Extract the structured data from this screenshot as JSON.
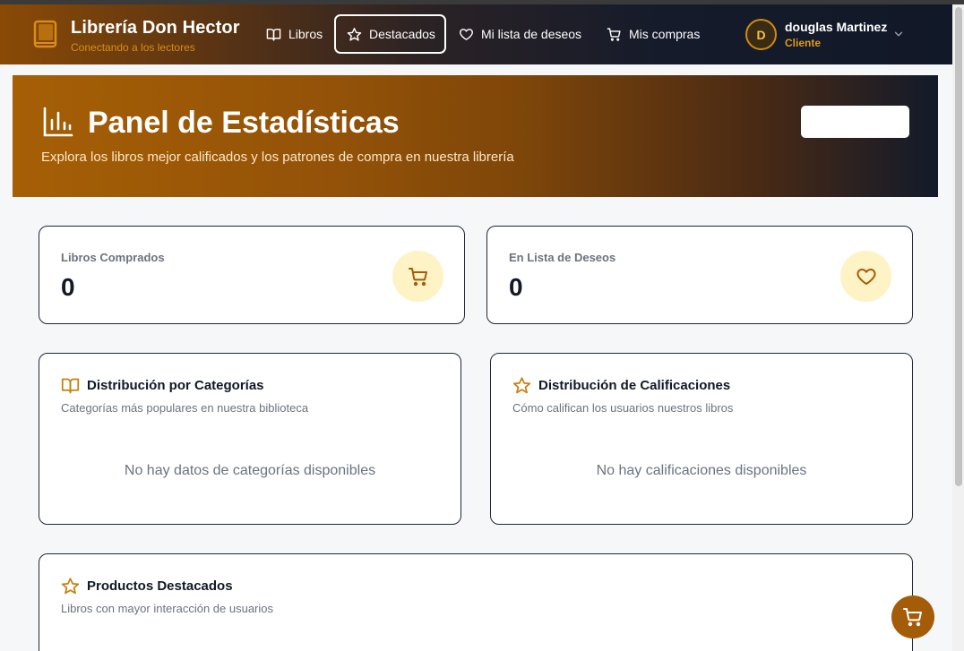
{
  "brand": {
    "title": "Librería Don Hector",
    "subtitle": "Conectando a los lectores"
  },
  "nav": {
    "items": [
      {
        "label": "Libros",
        "icon": "book-icon"
      },
      {
        "label": "Destacados",
        "icon": "star-icon",
        "active": true
      },
      {
        "label": "Mi lista de deseos",
        "icon": "heart-icon"
      },
      {
        "label": "Mis compras",
        "icon": "cart-icon"
      }
    ]
  },
  "user": {
    "initial": "D",
    "name": "douglas Martinez",
    "role": "Cliente"
  },
  "hero": {
    "title": "Panel de Estadísticas",
    "subtitle": "Explora los libros mejor calificados y los patrones de compra en nuestra librería"
  },
  "stats": [
    {
      "label": "Libros Comprados",
      "value": "0",
      "icon": "cart-icon"
    },
    {
      "label": "En Lista de Deseos",
      "value": "0",
      "icon": "heart-icon"
    }
  ],
  "sections": {
    "categories": {
      "title": "Distribución por Categorías",
      "subtitle": "Categorías más populares en nuestra biblioteca",
      "empty": "No hay datos de categorías disponibles"
    },
    "ratings": {
      "title": "Distribución de Calificaciones",
      "subtitle": "Cómo califican los usuarios nuestros libros",
      "empty": "No hay calificaciones disponibles"
    },
    "featured": {
      "title": "Productos Destacados",
      "subtitle": "Libros con mayor interacción de usuarios"
    }
  },
  "colors": {
    "accent": "#d18a10",
    "hero_start": "#a65f05",
    "nav_end": "#111827",
    "card_border": "#1f2937",
    "icon_bg": "#fdf3c4"
  }
}
